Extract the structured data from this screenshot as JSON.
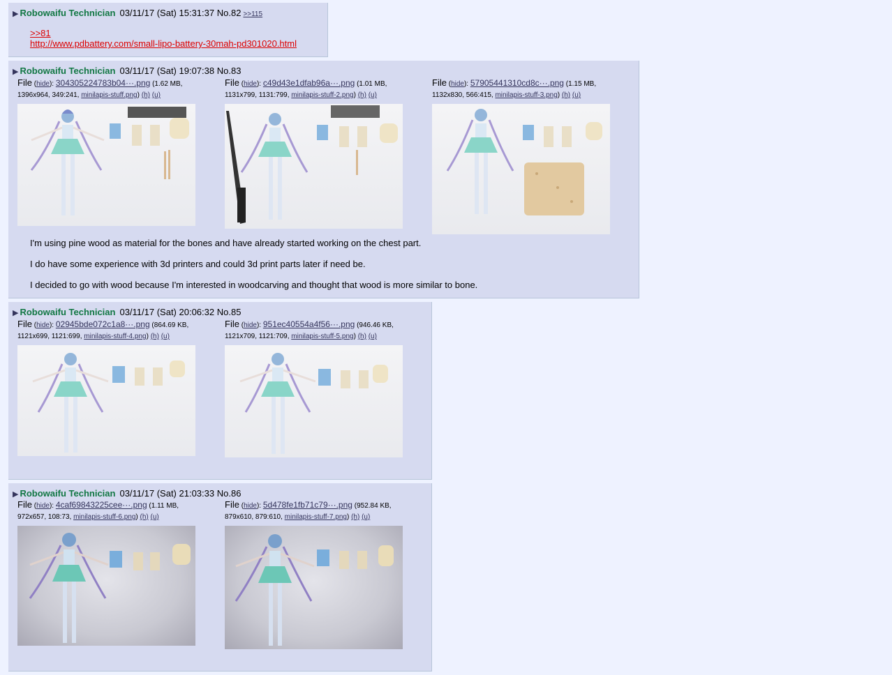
{
  "posts": [
    {
      "name": "Robowaifu Technician",
      "datetime": "03/11/17 (Sat) 15:31:37",
      "no": "No.82",
      "backlinks": ">>115",
      "quote": ">>81",
      "url": "http://www.pdbattery.com/small-lipo-battery-30mah-pd301020.html"
    },
    {
      "name": "Robowaifu Technician",
      "datetime": "03/11/17 (Sat) 19:07:38",
      "no": "No.83",
      "files": [
        {
          "name": "304305224783b04···.png",
          "size": "(1.62 MB,",
          "line2": "1396x964, 349:241,",
          "orig": "minilapis-stuff.png"
        },
        {
          "name": "c49d43e1dfab96a···.png",
          "size": "(1.01 MB,",
          "line2": "1131x799, 1131:799,",
          "orig": "minilapis-stuff-2.png"
        },
        {
          "name": "57905441310cd8c···.png",
          "size": "(1.15 MB,",
          "line2": "1132x830, 566:415,",
          "orig": "minilapis-stuff-3.png"
        }
      ],
      "text": [
        "I'm using pine wood as material for the bones and have already started working on the chest part.",
        "I do have some experience with 3d printers and could 3d print parts later if need be.",
        "I decided to go with wood because I'm interested in woodcarving and thought that wood is more similar to bone."
      ]
    },
    {
      "name": "Robowaifu Technician",
      "datetime": "03/11/17 (Sat) 20:06:32",
      "no": "No.85",
      "files": [
        {
          "name": "02945bde072c1a8···.png",
          "size": "(864.69 KB,",
          "line2": "1121x699, 1121:699,",
          "orig": "minilapis-stuff-4.png"
        },
        {
          "name": "951ec40554a4f56···.png",
          "size": "(946.46 KB,",
          "line2": "1121x709, 1121:709,",
          "orig": "minilapis-stuff-5.png"
        }
      ]
    },
    {
      "name": "Robowaifu Technician",
      "datetime": "03/11/17 (Sat) 21:03:33",
      "no": "No.86",
      "files": [
        {
          "name": "4caf69843225cee···.png",
          "size": "(1.11 MB,",
          "line2": "972x657, 108:73,",
          "orig": "minilapis-stuff-6.png"
        },
        {
          "name": "5d478fe1fb71c79···.png",
          "size": "(952.84 KB,",
          "line2": "879x610, 879:610,",
          "orig": "minilapis-stuff-7.png"
        }
      ]
    }
  ],
  "labels": {
    "file": "File",
    "hide": "hide",
    "h": "(h)",
    "u": "(u)",
    "expand_icon": "triangle-right-icon"
  },
  "colors": {
    "post_bg": "#d6daf0",
    "page_bg": "#eef2ff",
    "name": "#117743",
    "link": "#34345c",
    "quote": "#dd0000"
  }
}
